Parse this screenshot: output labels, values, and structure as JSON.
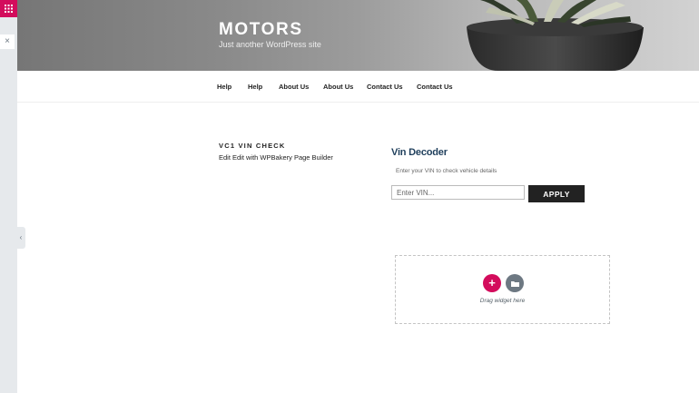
{
  "editor": {
    "grid_icon": "grid-icon",
    "close_symbol": "×",
    "collapse_symbol": "‹",
    "accent_color": "#d30c5c"
  },
  "site": {
    "title": "MOTORS",
    "tagline": "Just another WordPress site"
  },
  "nav": {
    "items": [
      {
        "label": "Help"
      },
      {
        "label": "Help"
      },
      {
        "label": "About Us"
      },
      {
        "label": "About Us"
      },
      {
        "label": "Contact Us"
      },
      {
        "label": "Contact Us"
      }
    ]
  },
  "post": {
    "title": "VC1 VIN CHECK",
    "edit_link": "Edit Edit with WPBakery Page Builder"
  },
  "vin_widget": {
    "heading": "Vin Decoder",
    "description": "Enter your VIN to check vehicle details",
    "input_placeholder": "Enter VIN...",
    "input_value": "",
    "apply_label": "APPLY"
  },
  "drop_zone": {
    "add_symbol": "+",
    "folder_icon": "folder-icon",
    "label": "Drag widget here"
  }
}
